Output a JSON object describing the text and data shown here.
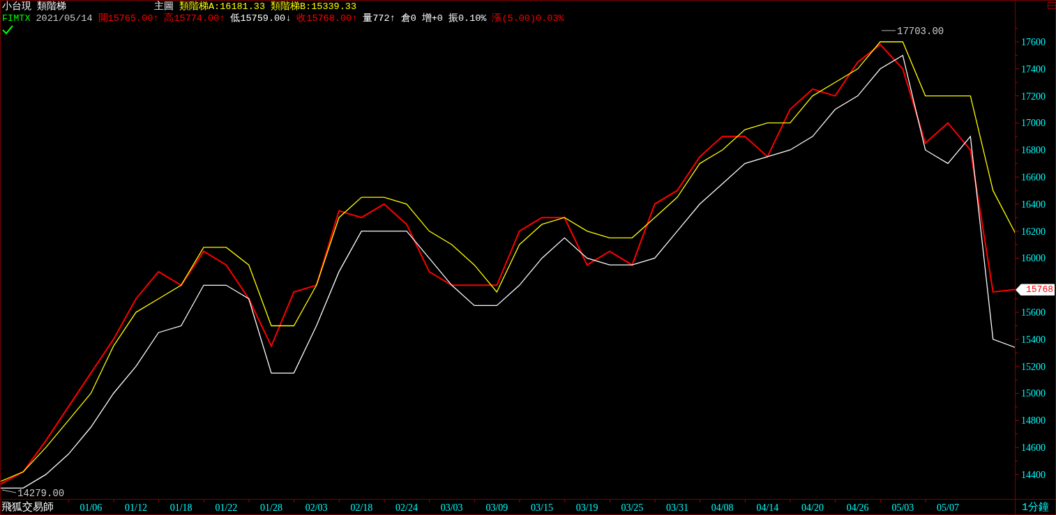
{
  "header": {
    "name": "小台現",
    "indicator": "類階梯",
    "pane": "主圖",
    "values": [
      {
        "label": "類階梯A:",
        "value": "16181.33"
      },
      {
        "label": "類階梯B:",
        "value": "15339.33"
      }
    ]
  },
  "quote": {
    "symbol": "FIMTX",
    "date": "2021/05/14",
    "items": [
      {
        "label": "開",
        "value": "15765.00",
        "arrow": "↑",
        "color": "#ff0000"
      },
      {
        "label": "高",
        "value": "15774.00",
        "arrow": "↑",
        "color": "#ff0000"
      },
      {
        "label": "低",
        "value": "15759.00",
        "arrow": "↓",
        "color": "#ffffff"
      },
      {
        "label": "收",
        "value": "15768.00",
        "arrow": "↑",
        "color": "#ff0000"
      },
      {
        "label": "量",
        "value": "772",
        "arrow": "↑",
        "color": "#ffffff"
      },
      {
        "label": "倉",
        "value": "0",
        "color": "#ffffff"
      },
      {
        "label": "增",
        "value": "+0",
        "color": "#ffffff"
      },
      {
        "label": "振",
        "value": "0.10%",
        "color": "#ffffff"
      },
      {
        "label": "漲",
        "value": "(5.00)0.03%",
        "color": "#ff0000"
      }
    ]
  },
  "markers": {
    "high_label": "17703.00",
    "low_label": "14279.00",
    "price_tag": "15768"
  },
  "footer": {
    "brand": "飛狐交易師",
    "period": "1分鐘"
  },
  "chart_data": {
    "type": "line",
    "ylim": [
      14214,
      17904
    ],
    "categories": [
      null,
      null,
      null,
      null,
      "01/06",
      null,
      "01/12",
      null,
      "01/18",
      null,
      "01/22",
      null,
      "01/28",
      null,
      "02/03",
      null,
      "02/18",
      null,
      "02/24",
      null,
      "03/03",
      null,
      "03/09",
      null,
      "03/15",
      null,
      "03/19",
      null,
      "03/25",
      null,
      "03/31",
      null,
      "04/08",
      null,
      "04/14",
      null,
      "04/20",
      null,
      "04/26",
      null,
      "05/03",
      null,
      "05/07",
      null,
      null,
      null
    ],
    "yticks": [
      14400,
      14600,
      14800,
      15000,
      15200,
      15400,
      15600,
      16000,
      16200,
      16400,
      16600,
      16800,
      17000,
      17200,
      17400,
      17600
    ],
    "series": [
      {
        "color": "#ff0000",
        "values": [
          14330,
          14420,
          14650,
          14900,
          15150,
          15400,
          15700,
          15900,
          15800,
          16050,
          15950,
          15700,
          15350,
          15750,
          15800,
          16350,
          16300,
          16400,
          16250,
          15900,
          15800,
          15800,
          15800,
          16200,
          16300,
          16300,
          15950,
          16050,
          15950,
          16400,
          16500,
          16750,
          16900,
          16900,
          16750,
          17100,
          17250,
          17200,
          17450,
          17580,
          17400,
          16850,
          17000,
          16800,
          15750,
          15768
        ]
      },
      {
        "color": "#ffff00",
        "values": [
          14350,
          14420,
          14600,
          14800,
          15000,
          15350,
          15600,
          15700,
          15800,
          16080,
          16080,
          15950,
          15500,
          15500,
          15800,
          16300,
          16450,
          16450,
          16400,
          16200,
          16100,
          15950,
          15750,
          16100,
          16250,
          16300,
          16200,
          16150,
          16150,
          16300,
          16450,
          16700,
          16800,
          16950,
          17000,
          17000,
          17200,
          17300,
          17400,
          17600,
          17600,
          17200,
          17200,
          17200,
          16500,
          16181
        ]
      },
      {
        "color": "#ffffff",
        "values": [
          14300,
          14300,
          14400,
          14550,
          14750,
          15000,
          15200,
          15450,
          15500,
          15800,
          15800,
          15700,
          15150,
          15150,
          15500,
          15900,
          16200,
          16200,
          16200,
          16000,
          15800,
          15650,
          15650,
          15800,
          16000,
          16150,
          16000,
          15950,
          15950,
          16000,
          16200,
          16400,
          16550,
          16700,
          16750,
          16800,
          16900,
          17100,
          17200,
          17400,
          17500,
          16800,
          16700,
          16900,
          15400,
          15339
        ]
      }
    ]
  }
}
